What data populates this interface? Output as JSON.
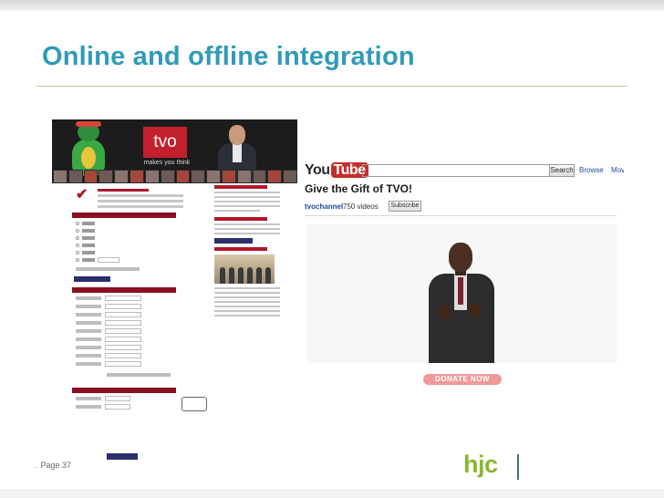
{
  "slide": {
    "title": "Online and offline integration",
    "page_label": "Page 37",
    "logo": "hjc",
    "accent_color": "#2f9bb8",
    "logo_color": "#8bb632"
  },
  "tvo_page": {
    "logo_text": "tvo",
    "tagline": "makes you think",
    "brand_color": "#c3202c"
  },
  "youtube_page": {
    "logo_you": "You",
    "logo_tube": "Tube",
    "search_button": "Search",
    "nav_browse": "Browse",
    "nav_more": "Mov",
    "headline": "Give the Gift of TVO!",
    "channel": "tvochannel",
    "video_count": "750 videos",
    "subscribe": "Subscribe",
    "donate": "DONATE NOW",
    "brand_color": "#c4302b"
  }
}
